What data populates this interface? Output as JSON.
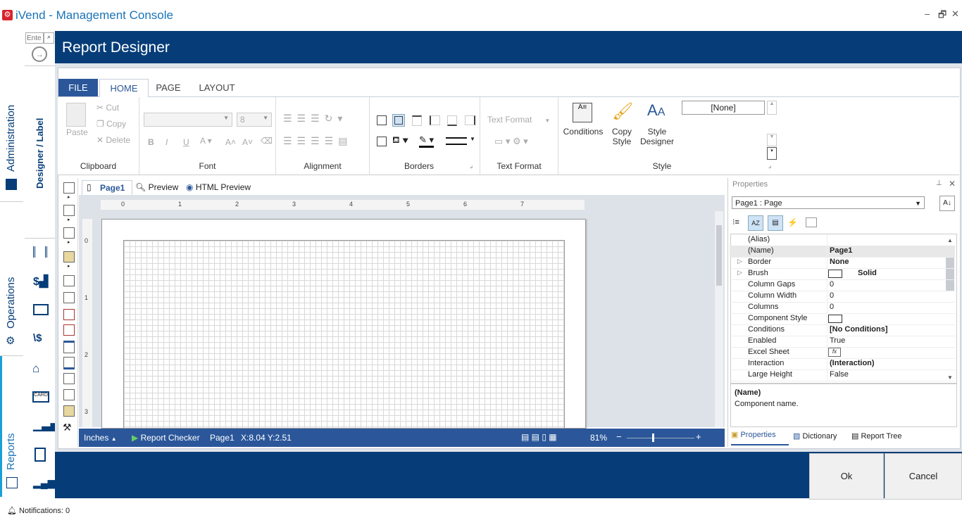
{
  "app": {
    "title": "iVend - Management Console"
  },
  "window_controls": {
    "minimize": "–",
    "restore": "🗗",
    "close": "✕"
  },
  "leftnav": {
    "tabs": [
      "Administration",
      "Operations",
      "Reports"
    ]
  },
  "subnav": {
    "search_placeholder": "Ente",
    "section_label": "Designer / Label"
  },
  "header": {
    "title": "Report Designer"
  },
  "ribbon_tabs": {
    "file": "FILE",
    "home": "HOME",
    "page": "PAGE",
    "layout": "LAYOUT"
  },
  "clipboard": {
    "paste": "Paste",
    "cut": "Cut",
    "copy": "Copy",
    "delete": "Delete",
    "label": "Clipboard"
  },
  "font": {
    "size": "8",
    "bold": "B",
    "italic": "I",
    "underline": "U",
    "label": "Font"
  },
  "alignment": {
    "label": "Alignment"
  },
  "borders": {
    "label": "Borders"
  },
  "text_format": {
    "combo": "Text Format",
    "label": "Text Format"
  },
  "style": {
    "conditions": "Conditions",
    "copy_style_1": "Copy",
    "copy_style_2": "Style",
    "style_designer_1": "Style",
    "style_designer_2": "Designer",
    "none_value": "[None]",
    "label": "Style"
  },
  "doc_tabs": {
    "page1": "Page1",
    "preview": "Preview",
    "html_preview": "HTML Preview"
  },
  "ruler_top": [
    "0",
    "1",
    "2",
    "3",
    "4",
    "5",
    "6",
    "7"
  ],
  "ruler_left": [
    "0",
    "1",
    "2",
    "3"
  ],
  "status": {
    "units": "Inches",
    "report_checker": "Report Checker",
    "page": "Page1",
    "coords": "X:8.04  Y:2.51",
    "zoom": "81%"
  },
  "properties": {
    "title": "Properties",
    "selector": "Page1 : Page",
    "rows": [
      {
        "k": "(Alias)",
        "v": "",
        "exp": ""
      },
      {
        "k": "(Name)",
        "v": "Page1",
        "exp": "",
        "bold": true
      },
      {
        "k": "Border",
        "v": "None",
        "exp": "▷",
        "bold": true
      },
      {
        "k": "Brush",
        "v": "Solid",
        "exp": "▷",
        "bold": true,
        "swatch": true
      },
      {
        "k": "Column Gaps",
        "v": "0",
        "exp": ""
      },
      {
        "k": "Column Width",
        "v": "0",
        "exp": ""
      },
      {
        "k": "Columns",
        "v": "0",
        "exp": ""
      },
      {
        "k": "Component Style",
        "v": "",
        "exp": "",
        "swatch": true
      },
      {
        "k": "Conditions",
        "v": "[No Conditions]",
        "exp": "",
        "bold": true
      },
      {
        "k": "Enabled",
        "v": "True",
        "exp": ""
      },
      {
        "k": "Excel Sheet",
        "v": "",
        "exp": "",
        "fx": true
      },
      {
        "k": "Interaction",
        "v": "(Interaction)",
        "exp": "",
        "bold": true
      },
      {
        "k": "Large Height",
        "v": "False",
        "exp": ""
      }
    ],
    "desc_title": "(Name)",
    "desc_text": "Component name.",
    "bottom_tabs": [
      "Properties",
      "Dictionary",
      "Report Tree"
    ]
  },
  "buttons": {
    "ok": "Ok",
    "cancel": "Cancel"
  },
  "notifications": {
    "text": "Notifications: 0"
  }
}
